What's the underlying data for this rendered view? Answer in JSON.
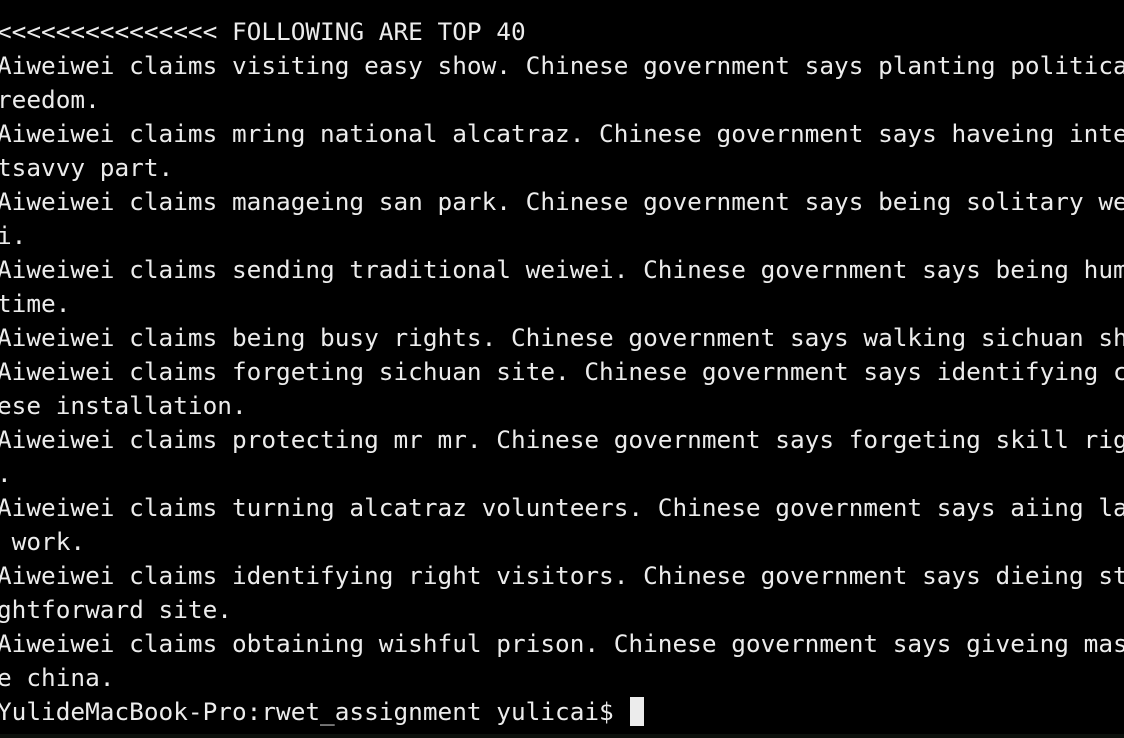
{
  "terminal": {
    "lines": [
      "<<<<<<<<<<<<<<< FOLLOWING ARE TOP 40",
      "Aiweiwei claims visiting easy show. Chinese government says planting political f",
      "reedom.",
      "Aiweiwei claims mring national alcatraz. Chinese government says haveing interne",
      "tsavvy part.",
      "Aiweiwei claims manageing san park. Chinese government says being solitary weiwe",
      "i.",
      "Aiweiwei claims sending traditional weiwei. Chinese government says being human",
      "time.",
      "Aiweiwei claims being busy rights. Chinese government says walking sichuan show.",
      "Aiweiwei claims forgeting sichuan site. Chinese government says identifying chin",
      "ese installation.",
      "Aiweiwei claims protecting mr mr. Chinese government says forgeting skill rights",
      ".",
      "Aiweiwei claims turning alcatraz volunteers. Chinese government says aiing large",
      " work.",
      "Aiweiwei claims identifying right visitors. Chinese government says dieing strai",
      "ghtforward site.",
      "Aiweiwei claims obtaining wishful prison. Chinese government says giveing massiv",
      "e china."
    ],
    "prompt": "YulideMacBook-Pro:rwet_assignment yulicai$ ",
    "colors": {
      "background": "#000000",
      "foreground": "#ececec"
    }
  }
}
